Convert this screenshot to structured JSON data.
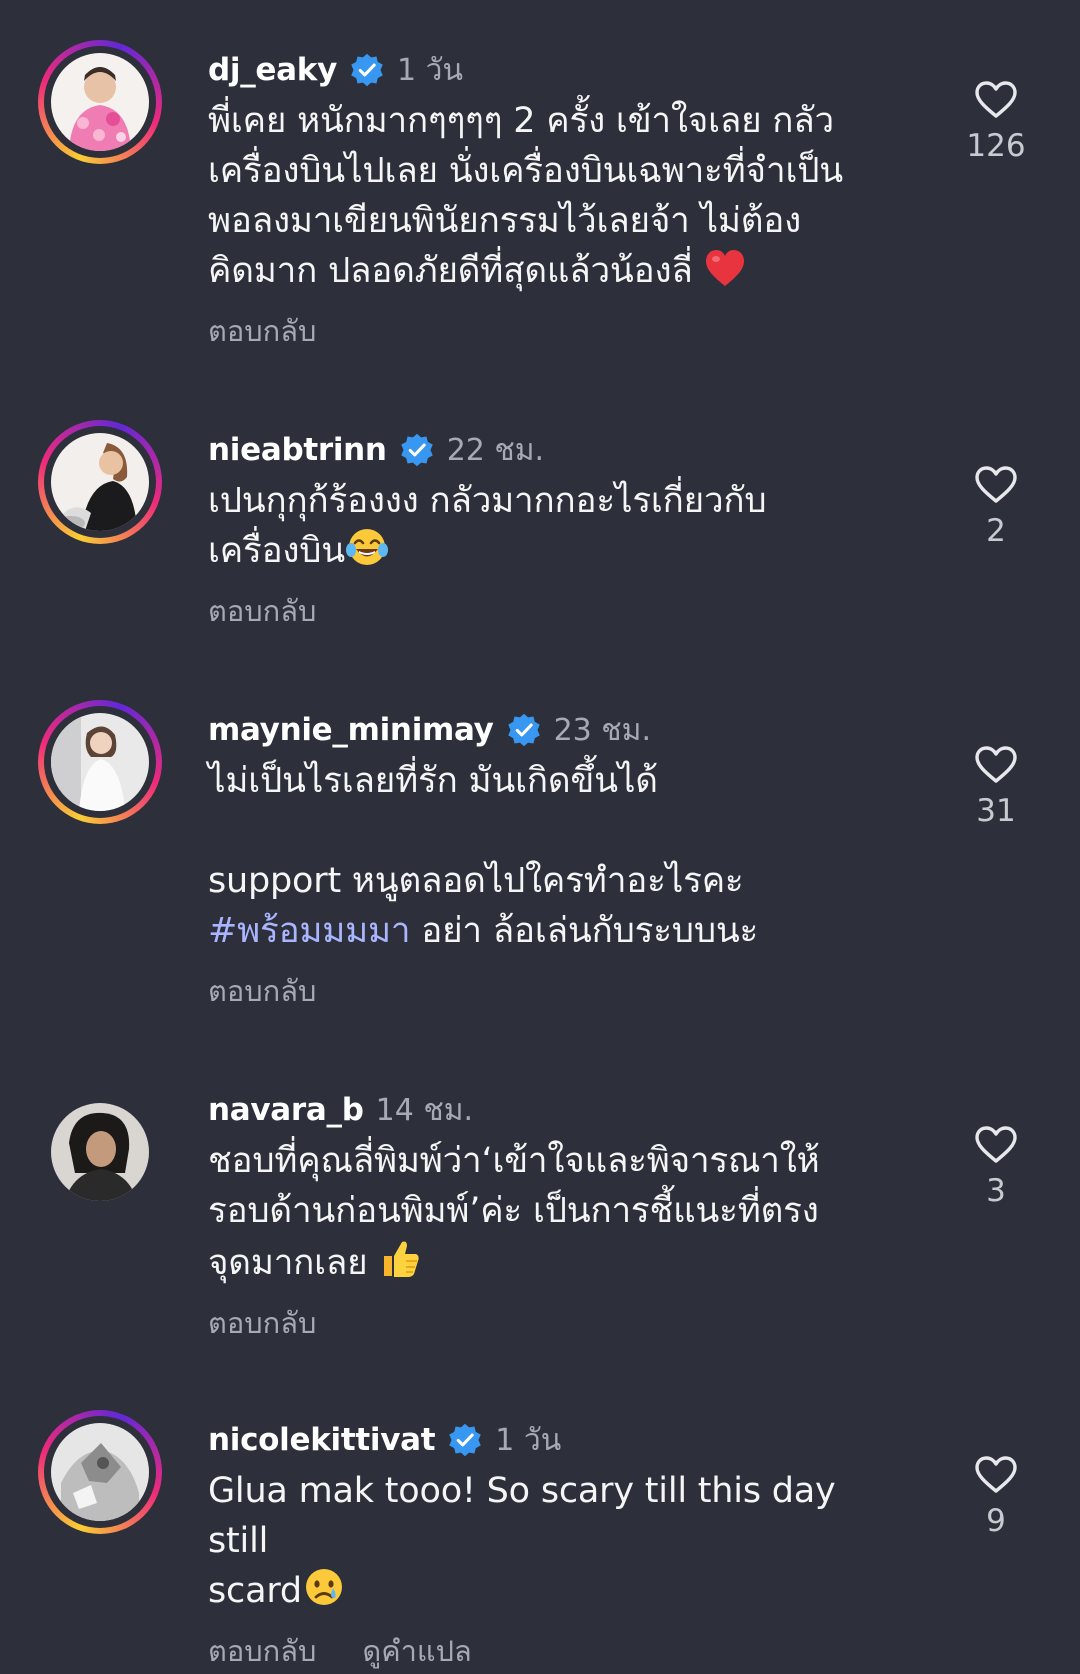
{
  "comments": [
    {
      "username": "dj_eaky",
      "verified": true,
      "time": "1 วัน",
      "lines": [
        "พี่เคย หนักมากๆๆๆๆ 2 ครั้ง เข้าใจเลย กลัว",
        "เครื่องบินไปเลย นั่งเครื่องบินเฉพาะที่จำเป็น",
        "พอลงมาเขียนพินัยกรรมไว้เลยจ้า ไม่ต้อง",
        "คิดมาก ปลอดภัยดีที่สุดแล้วน้องลี่ "
      ],
      "reply": "ตอบกลับ",
      "likes": "126"
    },
    {
      "username": "nieabtrinn",
      "verified": true,
      "time": "22 ชม.",
      "lines": [
        "เปนกุกุก้ร้องงง กลัวมากกอะไรเกี่ยวกับ",
        "เครื่องบิน"
      ],
      "reply": "ตอบกลับ",
      "likes": "2"
    },
    {
      "username": "maynie_minimay",
      "verified": true,
      "time": "23 ชม.",
      "line1": "ไม่เป็นไรเลยที่รัก มันเกิดขึ้นได้",
      "line2": "support หนูตลอดไปใครทำอะไรคะ",
      "hashtag": "#พร้อมมมมา",
      "line3_rest": " อย่า ล้อเล่นกับระบบนะ",
      "reply": "ตอบกลับ",
      "likes": "31"
    },
    {
      "username": "navara_b",
      "verified": false,
      "time": "14 ชม.",
      "lines": [
        "ชอบที่คุณลี่พิมพ์ว่า‘เข้าใจและพิจารณาให้",
        "รอบด้านก่อนพิมพ์’ค่ะ เป็นการชี้แนะที่ตรง",
        "จุดมากเลย "
      ],
      "reply": "ตอบกลับ",
      "likes": "3"
    },
    {
      "username": "nicolekittivat",
      "verified": true,
      "time": "1 วัน",
      "lines": [
        "Glua mak tooo! So scary till this day still",
        "scard"
      ],
      "reply": "ตอบกลับ",
      "translate": "ดูคำแปล",
      "likes": "9"
    }
  ],
  "colors": {
    "background": "#2d2f3a",
    "verified": "#3897f0",
    "hashtag": "#a9b6ff",
    "secondary_text": "#a8a9b2"
  },
  "icons": [
    "verified-badge-icon",
    "heart-outline-icon",
    "red-heart-emoji",
    "laughing-tears-emoji",
    "thumbs-up-emoji",
    "crying-face-emoji"
  ]
}
